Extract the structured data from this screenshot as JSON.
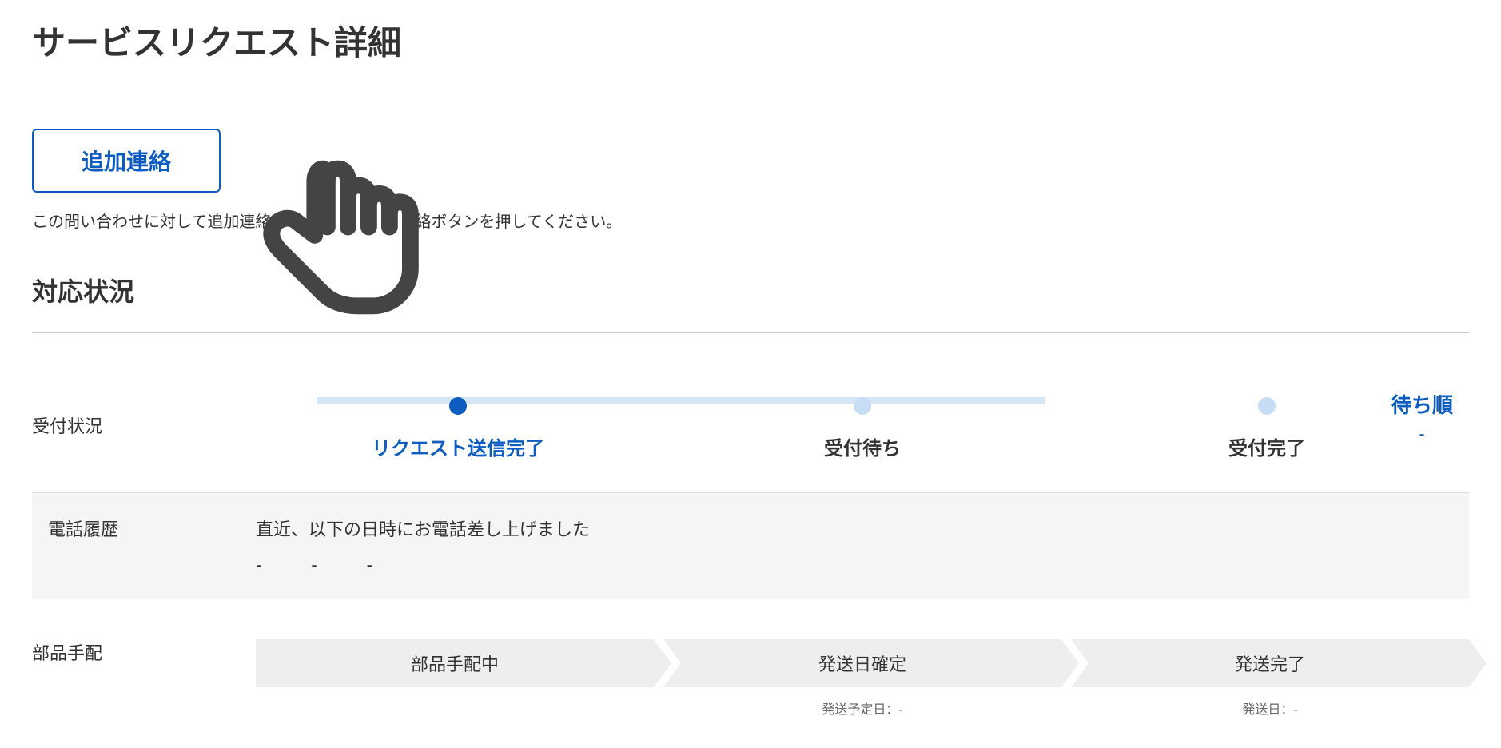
{
  "page": {
    "title": "サービスリクエスト詳細"
  },
  "contact": {
    "button_label": "追加連絡",
    "note": "この問い合わせに対して追加連絡をする場合は追加連絡ボタンを押してください。"
  },
  "status": {
    "heading": "対応状況",
    "row_label": "受付状況",
    "steps": [
      {
        "label": "リクエスト送信完了",
        "active": true
      },
      {
        "label": "受付待ち",
        "active": false
      },
      {
        "label": "受付完了",
        "active": false
      }
    ],
    "waiting": {
      "label": "待ち順",
      "value": "-"
    }
  },
  "phone": {
    "row_label": "電話履歴",
    "text": "直近、以下の日時にお電話差し上げました",
    "times_placeholder": "-　　-　　-"
  },
  "parts": {
    "row_label": "部品手配",
    "steps": [
      {
        "label": "部品手配中",
        "sub": ""
      },
      {
        "label": "発送日確定",
        "sub": "発送予定日：-"
      },
      {
        "label": "発送完了",
        "sub": "発送日：-"
      }
    ]
  }
}
